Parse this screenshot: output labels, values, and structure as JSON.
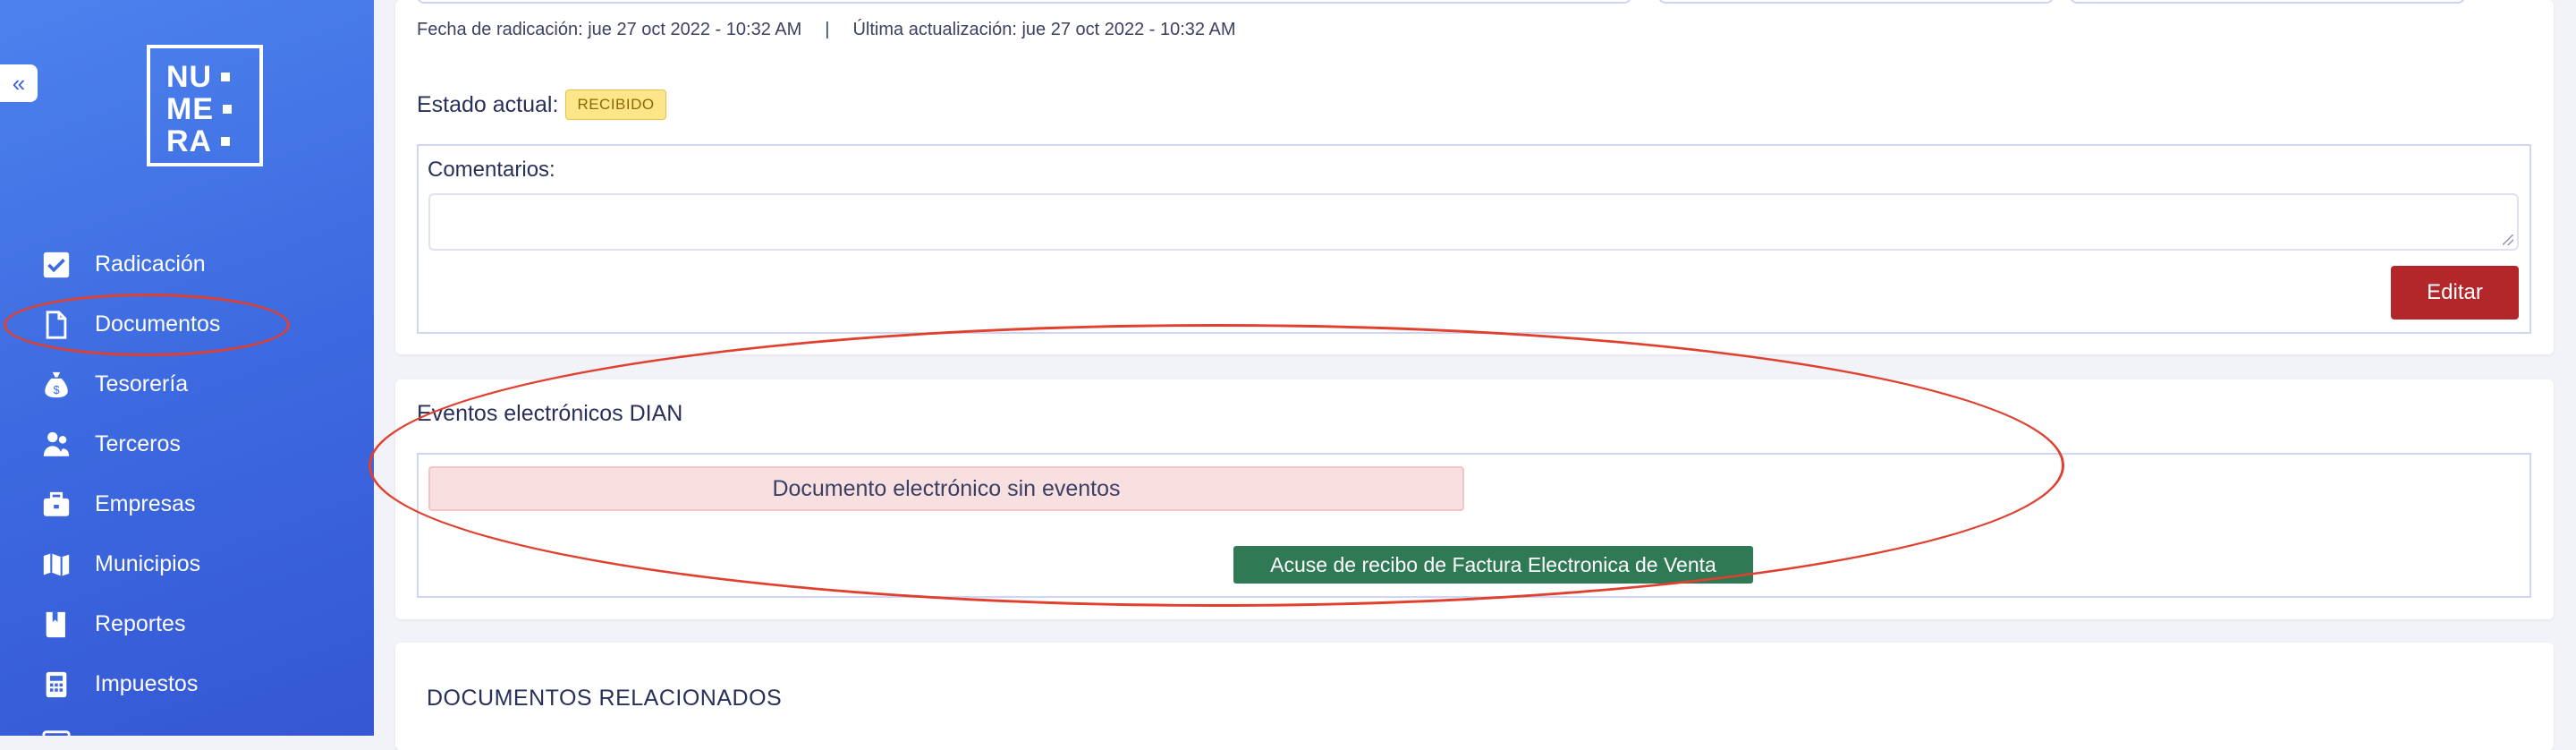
{
  "sidebar": {
    "collapse_icon": "«",
    "logo": {
      "rows": [
        "NU",
        "ME",
        "RA"
      ]
    },
    "items": [
      {
        "label": "Radicación",
        "icon": "checkbox-icon"
      },
      {
        "label": "Documentos",
        "icon": "document-icon"
      },
      {
        "label": "Tesorería",
        "icon": "money-bag-icon"
      },
      {
        "label": "Terceros",
        "icon": "people-icon"
      },
      {
        "label": "Empresas",
        "icon": "briefcase-icon"
      },
      {
        "label": "Municipios",
        "icon": "map-icon"
      },
      {
        "label": "Reportes",
        "icon": "book-icon"
      },
      {
        "label": "Impuestos",
        "icon": "calculator-icon"
      }
    ]
  },
  "document": {
    "fecha_radicacion": "Fecha de radicación: jue 27 oct 2022 - 10:32 AM",
    "separator": "|",
    "ultima_actualizacion": "Última actualización: jue 27 oct 2022 - 10:32 AM",
    "estado_label": "Estado actual:",
    "estado_value": "RECIBIDO",
    "comentarios_label": "Comentarios:",
    "comentarios_value": "",
    "edit_button": "Editar"
  },
  "eventos": {
    "title": "Eventos electrónicos DIAN",
    "empty_message": "Documento electrónico sin eventos",
    "acuse_button": "Acuse de recibo de Factura Electronica de Venta"
  },
  "relacionados": {
    "title": "DOCUMENTOS RELACIONADOS"
  },
  "colors": {
    "sidebar": "#4274e6",
    "badge_bg": "#fde68a",
    "edit_button": "#b3262a",
    "acuse_button": "#2f7a55",
    "alert_bg": "#f8e0e0",
    "annotation": "#e0402d"
  }
}
